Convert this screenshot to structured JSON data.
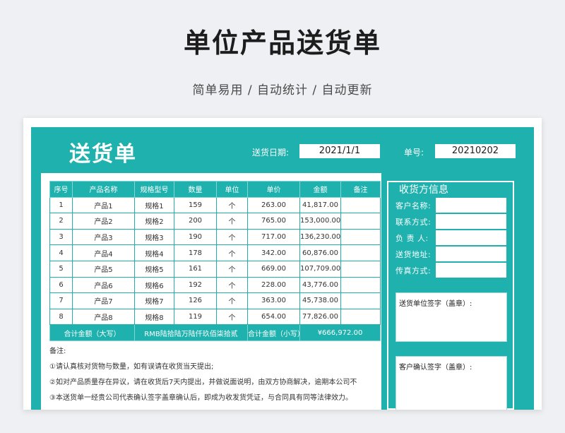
{
  "page": {
    "title": "单位产品送货单",
    "subtitle": "简单易用 / 自动统计 / 自动更新"
  },
  "doc": {
    "title": "送货单",
    "date_label": "送货日期:",
    "date_value": "2021/1/1",
    "no_label": "单号:",
    "no_value": "20210202"
  },
  "table": {
    "headers": [
      "序号",
      "产品名称",
      "规格型号",
      "数量",
      "单位",
      "单价",
      "金额",
      "备注"
    ],
    "rows": [
      [
        "1",
        "产品1",
        "规格1",
        "159",
        "个",
        "263.00",
        "41,817.00",
        ""
      ],
      [
        "2",
        "产品2",
        "规格2",
        "200",
        "个",
        "765.00",
        "153,000.00",
        ""
      ],
      [
        "3",
        "产品3",
        "规格3",
        "190",
        "个",
        "717.00",
        "136,230.00",
        ""
      ],
      [
        "4",
        "产品4",
        "规格4",
        "178",
        "个",
        "342.00",
        "60,876.00",
        ""
      ],
      [
        "5",
        "产品5",
        "规格5",
        "161",
        "个",
        "669.00",
        "107,709.00",
        ""
      ],
      [
        "6",
        "产品6",
        "规格6",
        "192",
        "个",
        "228.00",
        "43,776.00",
        ""
      ],
      [
        "7",
        "产品7",
        "规格7",
        "126",
        "个",
        "363.00",
        "45,738.00",
        ""
      ],
      [
        "8",
        "产品8",
        "规格8",
        "119",
        "个",
        "654.00",
        "77,826.00",
        ""
      ]
    ],
    "total_upper_label": "合计金额（大写）",
    "total_upper_value": "RMB陆拾陆万陆仟玖佰柒拾贰",
    "total_lower_label": "合计金额（小写）",
    "total_lower_value": "¥666,972.00"
  },
  "notes": {
    "label": "备注:",
    "lines": [
      "①请认真核对货物与数量，如有误请在收货当天提出;",
      "②如对产品质量存在异议，请在收货后7天内提出，并做说面说明，由双方协商解决，逾期本公司不",
      "③本送货单一经贵公司代表确认签字盖章确认后，即成为收发货凭证，与合同具有同等法律效力。"
    ]
  },
  "receiver": {
    "title": "收货方信息",
    "fields": [
      "客户名称:",
      "联系方式:",
      "负 责 人:",
      "送货地址:",
      "传真方式:"
    ],
    "sender_sign": "送货单位签字（盖章）:",
    "customer_sign": "客户确认签字（盖章）:"
  }
}
